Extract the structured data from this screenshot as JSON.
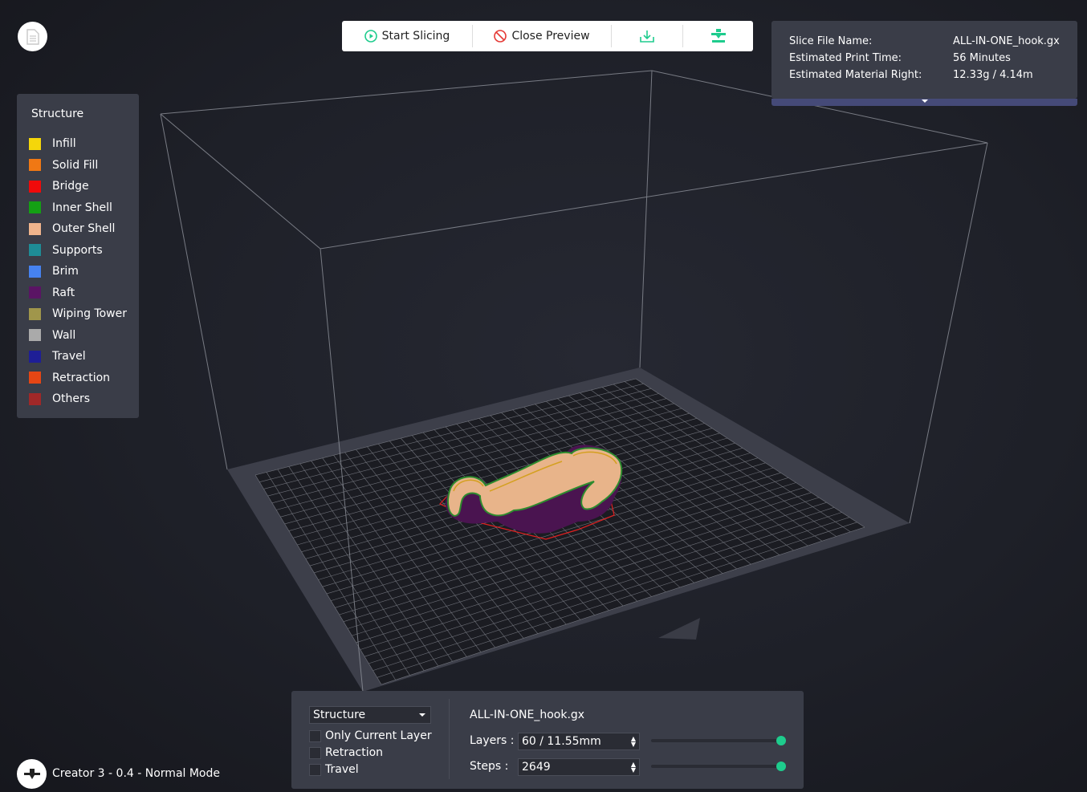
{
  "toolbar": {
    "start_slicing_label": "Start Slicing",
    "close_preview_label": "Close Preview",
    "download_icon": "download-icon",
    "print_icon": "printer-nozzle-icon",
    "accent_green": "#1ecc8d",
    "accent_red": "#e53935"
  },
  "info": {
    "file_name_label": "Slice File Name:",
    "file_name_value": "ALL-IN-ONE_hook.gx",
    "print_time_label": "Estimated Print Time:",
    "print_time_value": "56 Minutes",
    "material_label": "Estimated Material Right:",
    "material_value": "12.33g / 4.14m"
  },
  "legend": {
    "title": "Structure",
    "items": [
      {
        "label": "Infill",
        "color": "#f5d60a"
      },
      {
        "label": "Solid Fill",
        "color": "#f07814"
      },
      {
        "label": "Bridge",
        "color": "#f00a0a"
      },
      {
        "label": "Inner Shell",
        "color": "#14a014"
      },
      {
        "label": "Outer Shell",
        "color": "#f0b48c"
      },
      {
        "label": "Supports",
        "color": "#1e8c96"
      },
      {
        "label": "Brim",
        "color": "#4682f0"
      },
      {
        "label": "Raft",
        "color": "#5a1464"
      },
      {
        "label": "Wiping Tower",
        "color": "#a0964b"
      },
      {
        "label": "Wall",
        "color": "#aaaaaa"
      },
      {
        "label": "Travel",
        "color": "#1e1e96"
      },
      {
        "label": "Retraction",
        "color": "#e64614"
      },
      {
        "label": "Others",
        "color": "#a02828"
      }
    ]
  },
  "controls": {
    "view_mode": "Structure",
    "checkboxes": [
      {
        "label": "Only Current Layer",
        "checked": false
      },
      {
        "label": "Retraction",
        "checked": false
      },
      {
        "label": "Travel",
        "checked": false
      }
    ],
    "file_name": "ALL-IN-ONE_hook.gx",
    "layers_label": "Layers :",
    "layers_value": "60 / 11.55mm",
    "layers_slider_fraction": 1.0,
    "steps_label": "Steps :",
    "steps_value": "2649",
    "steps_slider_fraction": 1.0
  },
  "machine": {
    "label": "Creator 3 - 0.4 - Normal Mode",
    "icon": "printer-nozzle-icon"
  }
}
